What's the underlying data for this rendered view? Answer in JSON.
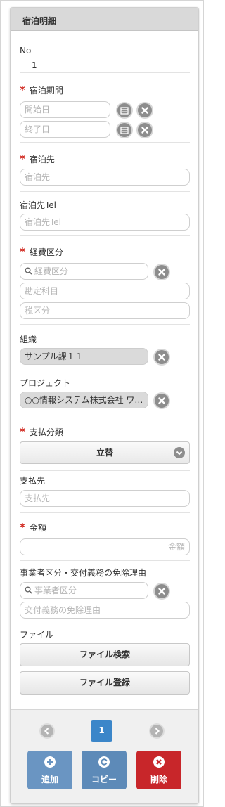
{
  "panel": {
    "title": "宿泊明細"
  },
  "no": {
    "label": "No",
    "value": "1"
  },
  "period": {
    "label": "宿泊期間",
    "start_placeholder": "開始日",
    "end_placeholder": "終了日"
  },
  "destination": {
    "label": "宿泊先",
    "placeholder": "宿泊先"
  },
  "destination_tel": {
    "label": "宿泊先Tel",
    "placeholder": "宿泊先Tel"
  },
  "expense": {
    "label": "経費区分",
    "placeholder": "経費区分",
    "account_placeholder": "勘定科目",
    "tax_placeholder": "税区分"
  },
  "organization": {
    "label": "組織",
    "value": "サンプル課１１"
  },
  "project": {
    "label": "プロジェクト",
    "value": "○○情報システム株式会社 ワ…"
  },
  "payment_type": {
    "label": "支払分類",
    "value": "立替"
  },
  "payee": {
    "label": "支払先",
    "placeholder": "支払先"
  },
  "amount": {
    "label": "金額",
    "placeholder": "金額"
  },
  "business": {
    "label": "事業者区分・交付義務の免除理由",
    "placeholder": "事業者区分",
    "reason_placeholder": "交付義務の免除理由"
  },
  "file": {
    "label": "ファイル",
    "search_label": "ファイル検索",
    "register_label": "ファイル登録"
  },
  "pager": {
    "current": "1"
  },
  "actions": {
    "add": "追加",
    "copy": "コピー",
    "delete": "削除"
  },
  "colors": {
    "required": "#d0241b",
    "page_active": "#3b86c9",
    "add_button": "#6a95c2",
    "copy_button": "#5d8ab8",
    "delete_button": "#c8262a"
  }
}
